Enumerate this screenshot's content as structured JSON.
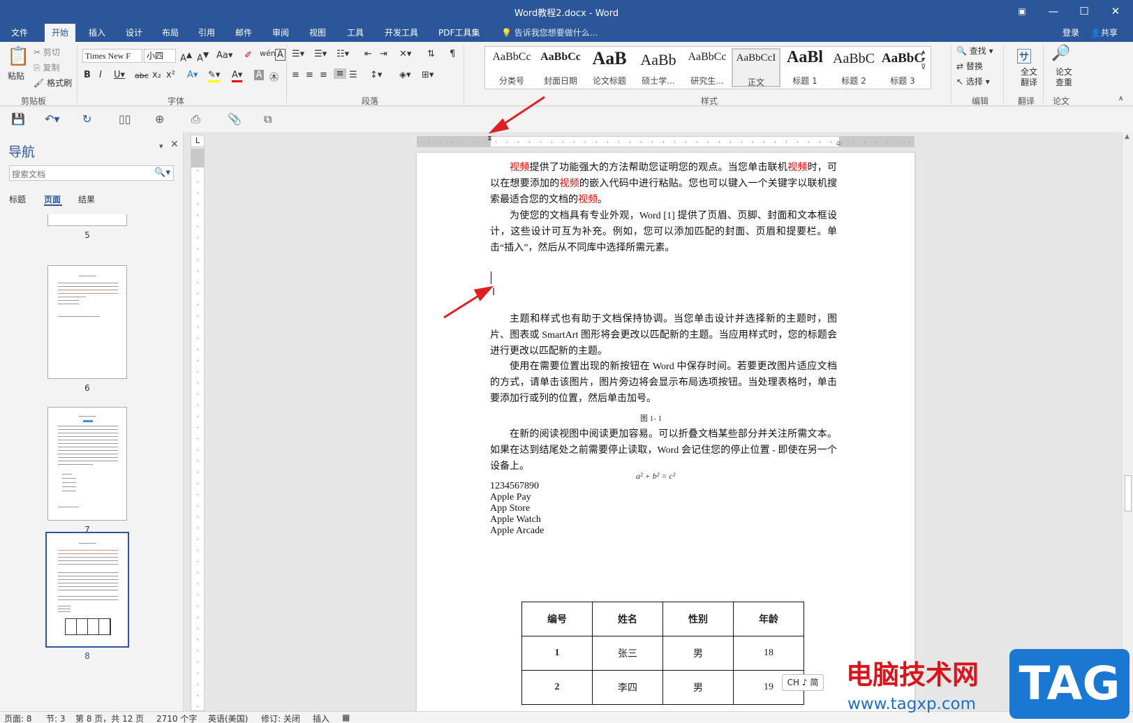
{
  "window": {
    "title": "Word教程2.docx - Word",
    "controls": [
      "▣",
      "—",
      "☐",
      "✕"
    ]
  },
  "ribbon_tabs": [
    "文件",
    "开始",
    "插入",
    "设计",
    "布局",
    "引用",
    "邮件",
    "审阅",
    "视图",
    "工具",
    "开发工具",
    "PDF工具集"
  ],
  "active_tab": "开始",
  "tell_me": "告诉我您想要做什么...",
  "account": {
    "login": "登录",
    "share": "共享"
  },
  "clipboard": {
    "paste": "粘贴",
    "cut": "剪切",
    "copy": "复制",
    "format_painter": "格式刷",
    "label": "剪贴板"
  },
  "font": {
    "name": "Times New F",
    "size": "小四",
    "label": "字体"
  },
  "paragraph": {
    "label": "段落"
  },
  "styles": {
    "label": "样式",
    "items": [
      {
        "sample": "AaBbCc",
        "name": "分类号"
      },
      {
        "sample": "AaBbCc",
        "name": "封面日期"
      },
      {
        "sample": "AaB",
        "name": "论文标题"
      },
      {
        "sample": "AaBb",
        "name": "硕士学..."
      },
      {
        "sample": "AaBbCc",
        "name": "研究生..."
      },
      {
        "sample": "AaBbCcI",
        "name": "正文"
      },
      {
        "sample": "AaBl",
        "name": "标题 1"
      },
      {
        "sample": "AaBbC",
        "name": "标题 2"
      },
      {
        "sample": "AaBbC",
        "name": "标题 3"
      }
    ]
  },
  "editing": {
    "find": "查找",
    "replace": "替换",
    "select": "选择",
    "label": "编辑"
  },
  "translate": {
    "button": "全文翻译",
    "label": "翻译"
  },
  "thesis": {
    "button": "论文查重",
    "label": "论文"
  },
  "nav_pane": {
    "title": "导航",
    "search_placeholder": "搜索文档",
    "tabs": [
      "标题",
      "页面",
      "结果"
    ],
    "active_tab": "页面",
    "pages": [
      "5",
      "6",
      "7",
      "8"
    ],
    "current_page": "8"
  },
  "document": {
    "p1": [
      {
        "t": "视频",
        "red": true
      },
      {
        "t": "提供了功能强大的方法帮助您证明您的观点。当您单击联机"
      },
      {
        "t": "视频",
        "red": true
      },
      {
        "t": "时，可以在想要添加的"
      },
      {
        "t": "视频",
        "red": true
      },
      {
        "t": "的嵌入代码中进行粘贴。您也可以键入一个关键字以联机搜索最适合您的文档的"
      },
      {
        "t": "视频",
        "red": true
      },
      {
        "t": "。"
      }
    ],
    "p2": "为使您的文档具有专业外观，Word [1] 提供了页眉、页脚、封面和文本框设计，这些设计可互为补充。例如，您可以添加匹配的封面、页眉和提要栏。单击“插入”，然后从不同库中选择所需元素。",
    "p3": "主题和样式也有助于文档保持协调。当您单击设计并选择新的主题时，图片、图表或 SmartArt 图形将会更改以匹配新的主题。当应用样式时，您的标题会进行更改以匹配新的主题。",
    "p4": "使用在需要位置出现的新按钮在 Word 中保存时间。若要更改图片适应文档的方式，请单击该图片，图片旁边将会显示布局选项按钮。当处理表格时，单击要添加行或列的位置，然后单击加号。",
    "caption": "图 1- 1",
    "p5": "在新的阅读视图中阅读更加容易。可以折叠文档某些部分并关注所需文本。如果在达到结尾处之前需要停止读取，Word 会记住您的停止位置 - 即使在另一个设备上。",
    "equation": "a² + b² = c²",
    "lines": [
      "1234567890",
      "Apple Pay",
      "App Store",
      "Apple Watch",
      "Apple Arcade"
    ],
    "table": {
      "headers": [
        "编号",
        "姓名",
        "性别",
        "年龄"
      ],
      "rows": [
        [
          "1",
          "张三",
          "男",
          "18"
        ],
        [
          "2",
          "李四",
          "男",
          "19"
        ]
      ]
    }
  },
  "status_bar": {
    "page": "页面: 8",
    "section": "节: 3",
    "page_of": "第 8 页，共 12 页",
    "words": "2710 个字",
    "language": "英语(美国)",
    "revision": "修订: 关闭",
    "insert": "插入"
  },
  "ime": "CH ♪ 简",
  "watermark": {
    "site": "电脑技术网",
    "url": "www.tagxp.com",
    "tag": "TAG"
  },
  "colors": {
    "accent": "#2b579a",
    "annotation_arrow": "#e02020",
    "highlight_red": "#e00000"
  }
}
